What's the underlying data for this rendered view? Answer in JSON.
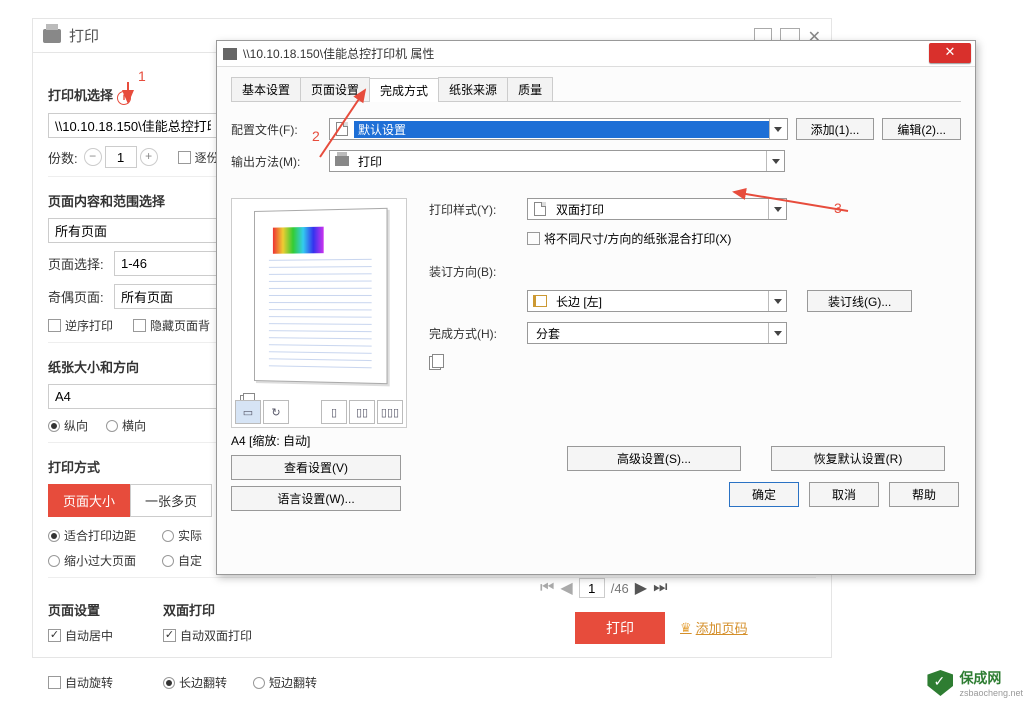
{
  "bg": {
    "title": "打印",
    "printer_select_label": "打印机选择",
    "printer_value": "\\\\10.10.18.150\\佳能总控打印",
    "copies_label": "份数:",
    "copies_value": "1",
    "copies_checkbox": "逐份",
    "content_range_title": "页面内容和范围选择",
    "all_pages": "所有页面",
    "page_select_label": "页面选择:",
    "page_select_value": "1-46",
    "odd_even_label": "奇偶页面:",
    "odd_even_value": "所有页面",
    "reverse_print": "逆序打印",
    "hide_bg": "隐藏页面背",
    "paper_size_title": "纸张大小和方向",
    "paper_size": "A4",
    "orient_portrait": "纵向",
    "orient_landscape": "横向",
    "print_mode_title": "打印方式",
    "toggle_page_size": "页面大小",
    "toggle_multi": "一张多页",
    "fit_margin": "适合打印边距",
    "actual": "实际",
    "shrink": "缩小过大页面",
    "custom": "自定",
    "page_settings_title": "页面设置",
    "duplex_title": "双面打印",
    "auto_center": "自动居中",
    "auto_rotate": "自动旋转",
    "auto_duplex": "自动双面打印",
    "long_edge": "长边翻转",
    "short_edge": "短边翻转"
  },
  "dlg": {
    "title": "\\\\10.10.18.150\\佳能总控打印机 属性",
    "tabs": [
      "基本设置",
      "页面设置",
      "完成方式",
      "纸张来源",
      "质量"
    ],
    "active_tab": 2,
    "profile_label": "配置文件(F):",
    "profile_value": "默认设置",
    "add_btn": "添加(1)...",
    "edit_btn": "编辑(2)...",
    "output_label": "输出方法(M):",
    "output_value": "打印",
    "print_style_label": "打印样式(Y):",
    "print_style_value": "双面打印",
    "mix_sizes": "将不同尺寸/方向的纸张混合打印(X)",
    "binding_dir_label": "装订方向(B):",
    "binding_dir_value": "长边 [左]",
    "binding_btn": "装订线(G)...",
    "finish_label": "完成方式(H):",
    "finish_value": "分套",
    "preview_caption": "A4 [缩放: 自动]",
    "view_settings_btn": "查看设置(V)",
    "lang_settings_btn": "语言设置(W)...",
    "advanced_btn": "高级设置(S)...",
    "restore_btn": "恢复默认设置(R)",
    "ok": "确定",
    "cancel": "取消",
    "help": "帮助"
  },
  "annotations": {
    "n1": "1",
    "n2": "2",
    "n3": "3"
  },
  "pager": {
    "current": "1",
    "total": "/46"
  },
  "actions": {
    "print": "打印",
    "add_page": "添加页码"
  },
  "watermark": {
    "name": "保成网",
    "url": "zsbaocheng.net"
  }
}
